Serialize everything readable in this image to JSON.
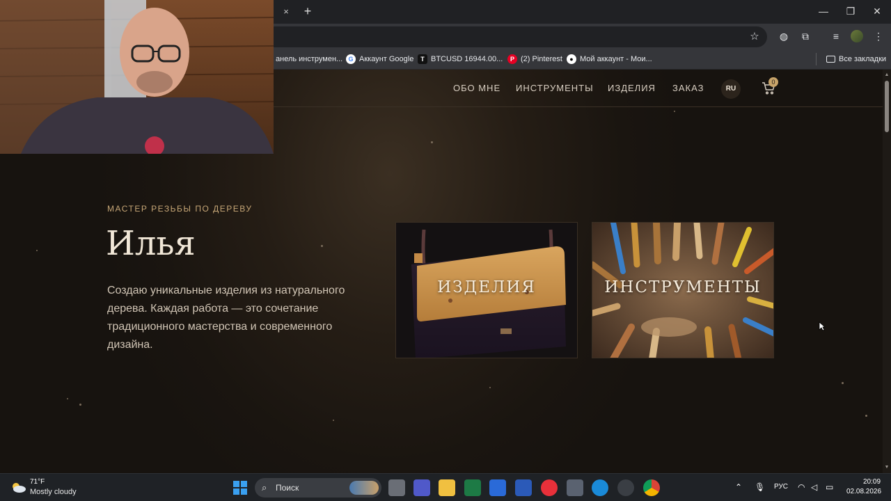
{
  "browser": {
    "tab_close": "×",
    "tab_new": "+",
    "window_controls": {
      "minimize": "—",
      "restore": "❐",
      "close": "✕"
    },
    "bookmarks": [
      {
        "label": "анель инструмен...",
        "icon": "folder-icon"
      },
      {
        "label": "Аккаунт Google",
        "icon": "google-icon"
      },
      {
        "label": "BTCUSD 16944.00...",
        "icon": "tradingview-icon"
      },
      {
        "label": "(2) Pinterest",
        "icon": "pinterest-icon"
      },
      {
        "label": "Мой аккаунт - Мои...",
        "icon": "account-icon"
      }
    ],
    "all_bookmarks": "Все закладки"
  },
  "site": {
    "nav": {
      "about": "ОБО МНЕ",
      "tools": "ИНСТРУМЕНТЫ",
      "products": "ИЗДЕЛИЯ",
      "order": "ЗАКАЗ",
      "lang": "RU",
      "cart_count": "0"
    },
    "hero": {
      "eyebrow": "МАСТЕР РЕЗЬБЫ ПО ДЕРЕВУ",
      "name": "Илья",
      "description": "Создаю уникальные изделия из натурального дерева. Каждая работа — это сочетание традиционного мастерства и современного дизайна."
    },
    "cards": [
      {
        "label": "ИЗДЕЛИЯ"
      },
      {
        "label": "ИНСТРУМЕНТЫ"
      }
    ]
  },
  "taskbar": {
    "weather_temp": "71°F",
    "weather_desc": "Mostly cloudy",
    "search_placeholder": "Поиск",
    "lang": "РУС",
    "time": "20:09",
    "date": "02.08.2026"
  },
  "colors": {
    "accent_gold": "#c7a777",
    "page_bg": "#1a1510",
    "text_light": "#f1e7d7"
  }
}
